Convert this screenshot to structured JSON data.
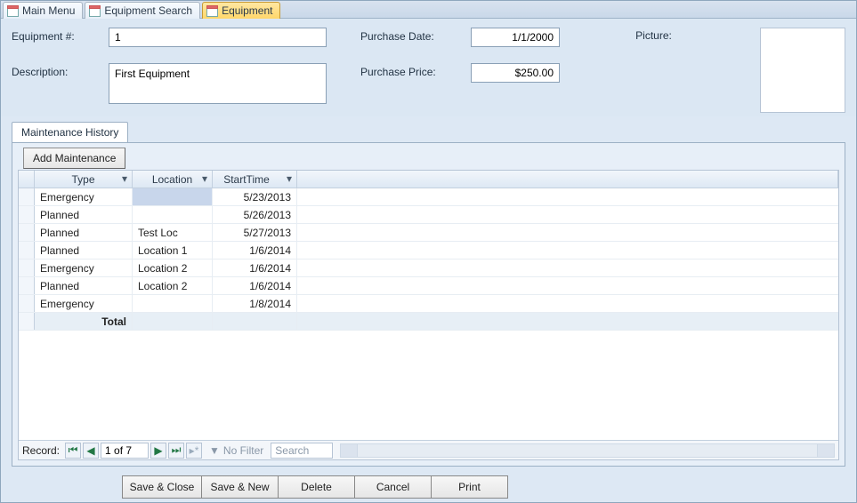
{
  "tabs": [
    {
      "label": "Main Menu",
      "active": false
    },
    {
      "label": "Equipment Search",
      "active": false
    },
    {
      "label": "Equipment",
      "active": true
    }
  ],
  "form": {
    "equipment_num_label": "Equipment #:",
    "equipment_num": "1",
    "description_label": "Description:",
    "description": "First Equipment",
    "purchase_date_label": "Purchase Date:",
    "purchase_date": "1/1/2000",
    "purchase_price_label": "Purchase Price:",
    "purchase_price": "$250.00",
    "picture_label": "Picture:"
  },
  "subtab": {
    "label": "Maintenance History",
    "add_button": "Add Maintenance",
    "columns": {
      "type": "Type",
      "location": "Location",
      "starttime": "StartTime"
    },
    "rows": [
      {
        "type": "Emergency",
        "location": "",
        "starttime": "5/23/2013",
        "sel_loc": true
      },
      {
        "type": "Planned",
        "location": "",
        "starttime": "5/26/2013"
      },
      {
        "type": "Planned",
        "location": "Test Loc",
        "starttime": "5/27/2013"
      },
      {
        "type": "Planned",
        "location": "Location 1",
        "starttime": "1/6/2014"
      },
      {
        "type": "Emergency",
        "location": "Location 2",
        "starttime": "1/6/2014"
      },
      {
        "type": "Planned",
        "location": "Location 2",
        "starttime": "1/6/2014"
      },
      {
        "type": "Emergency",
        "location": "",
        "starttime": "1/8/2014"
      }
    ],
    "total_label": "Total"
  },
  "recnav": {
    "label": "Record:",
    "position": "1 of 7",
    "no_filter": "No Filter",
    "search_placeholder": "Search"
  },
  "commands": {
    "save_close": "Save & Close",
    "save_new": "Save & New",
    "delete": "Delete",
    "cancel": "Cancel",
    "print": "Print"
  }
}
